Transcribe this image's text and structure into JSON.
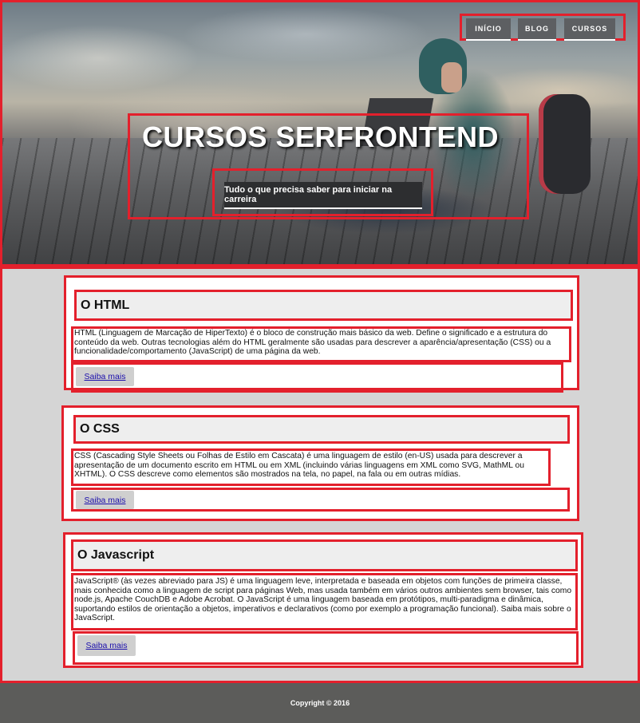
{
  "nav": {
    "items": [
      {
        "label": "INÍCIO"
      },
      {
        "label": "BLOG"
      },
      {
        "label": "CURSOS"
      }
    ]
  },
  "hero": {
    "title": "CURSOS SERFRONTEND",
    "subtitle": "Tudo o que precisa saber para iniciar na carreira"
  },
  "cards": [
    {
      "title": "O HTML",
      "text": "HTML (Linguagem de Marcação de HiperTexto) é o bloco de construção mais básico da web. Define o significado e a estrutura do conteúdo da web. Outras tecnologias além do HTML geralmente são usadas para descrever a aparência/apresentação (CSS) ou a funcionalidade/comportamento (JavaScript) de uma página da web.",
      "button": "Saiba mais"
    },
    {
      "title": "O CSS",
      "text": "CSS (Cascading Style Sheets ou Folhas de Estilo em Cascata) é uma linguagem de estilo (en-US) usada para descrever a apresentação de um documento escrito em HTML ou em XML (incluindo várias linguagens em XML como SVG, MathML ou XHTML). O CSS descreve como elementos são mostrados na tela, no papel, na fala ou em outras mídias.",
      "button": "Saiba mais"
    },
    {
      "title": "O Javascript",
      "text": "JavaScript® (às vezes abreviado para JS) é uma linguagem leve, interpretada e baseada em objetos com funções de primeira classe, mais conhecida como a linguagem de script para páginas Web, mas usada também em vários outros ambientes sem browser, tais como node.js, Apache CouchDB e Adobe Acrobat. O JavaScript é uma linguagem baseada em protótipos, multi-paradigma e dinâmica, suportando estilos de orientação a objetos, imperativos e declarativos (como por exemplo a programação funcional). Saiba mais sobre o JavaScript.",
      "button": "Saiba mais"
    }
  ],
  "footer": {
    "copyright": "Copyright © 2016"
  },
  "colors": {
    "annotation_outline": "#e3202c",
    "page_background": "#d5d5d5",
    "footer_background": "#5c5c5a",
    "nav_button": "#5d5f62",
    "subtitle_button": "#2d2e30"
  }
}
